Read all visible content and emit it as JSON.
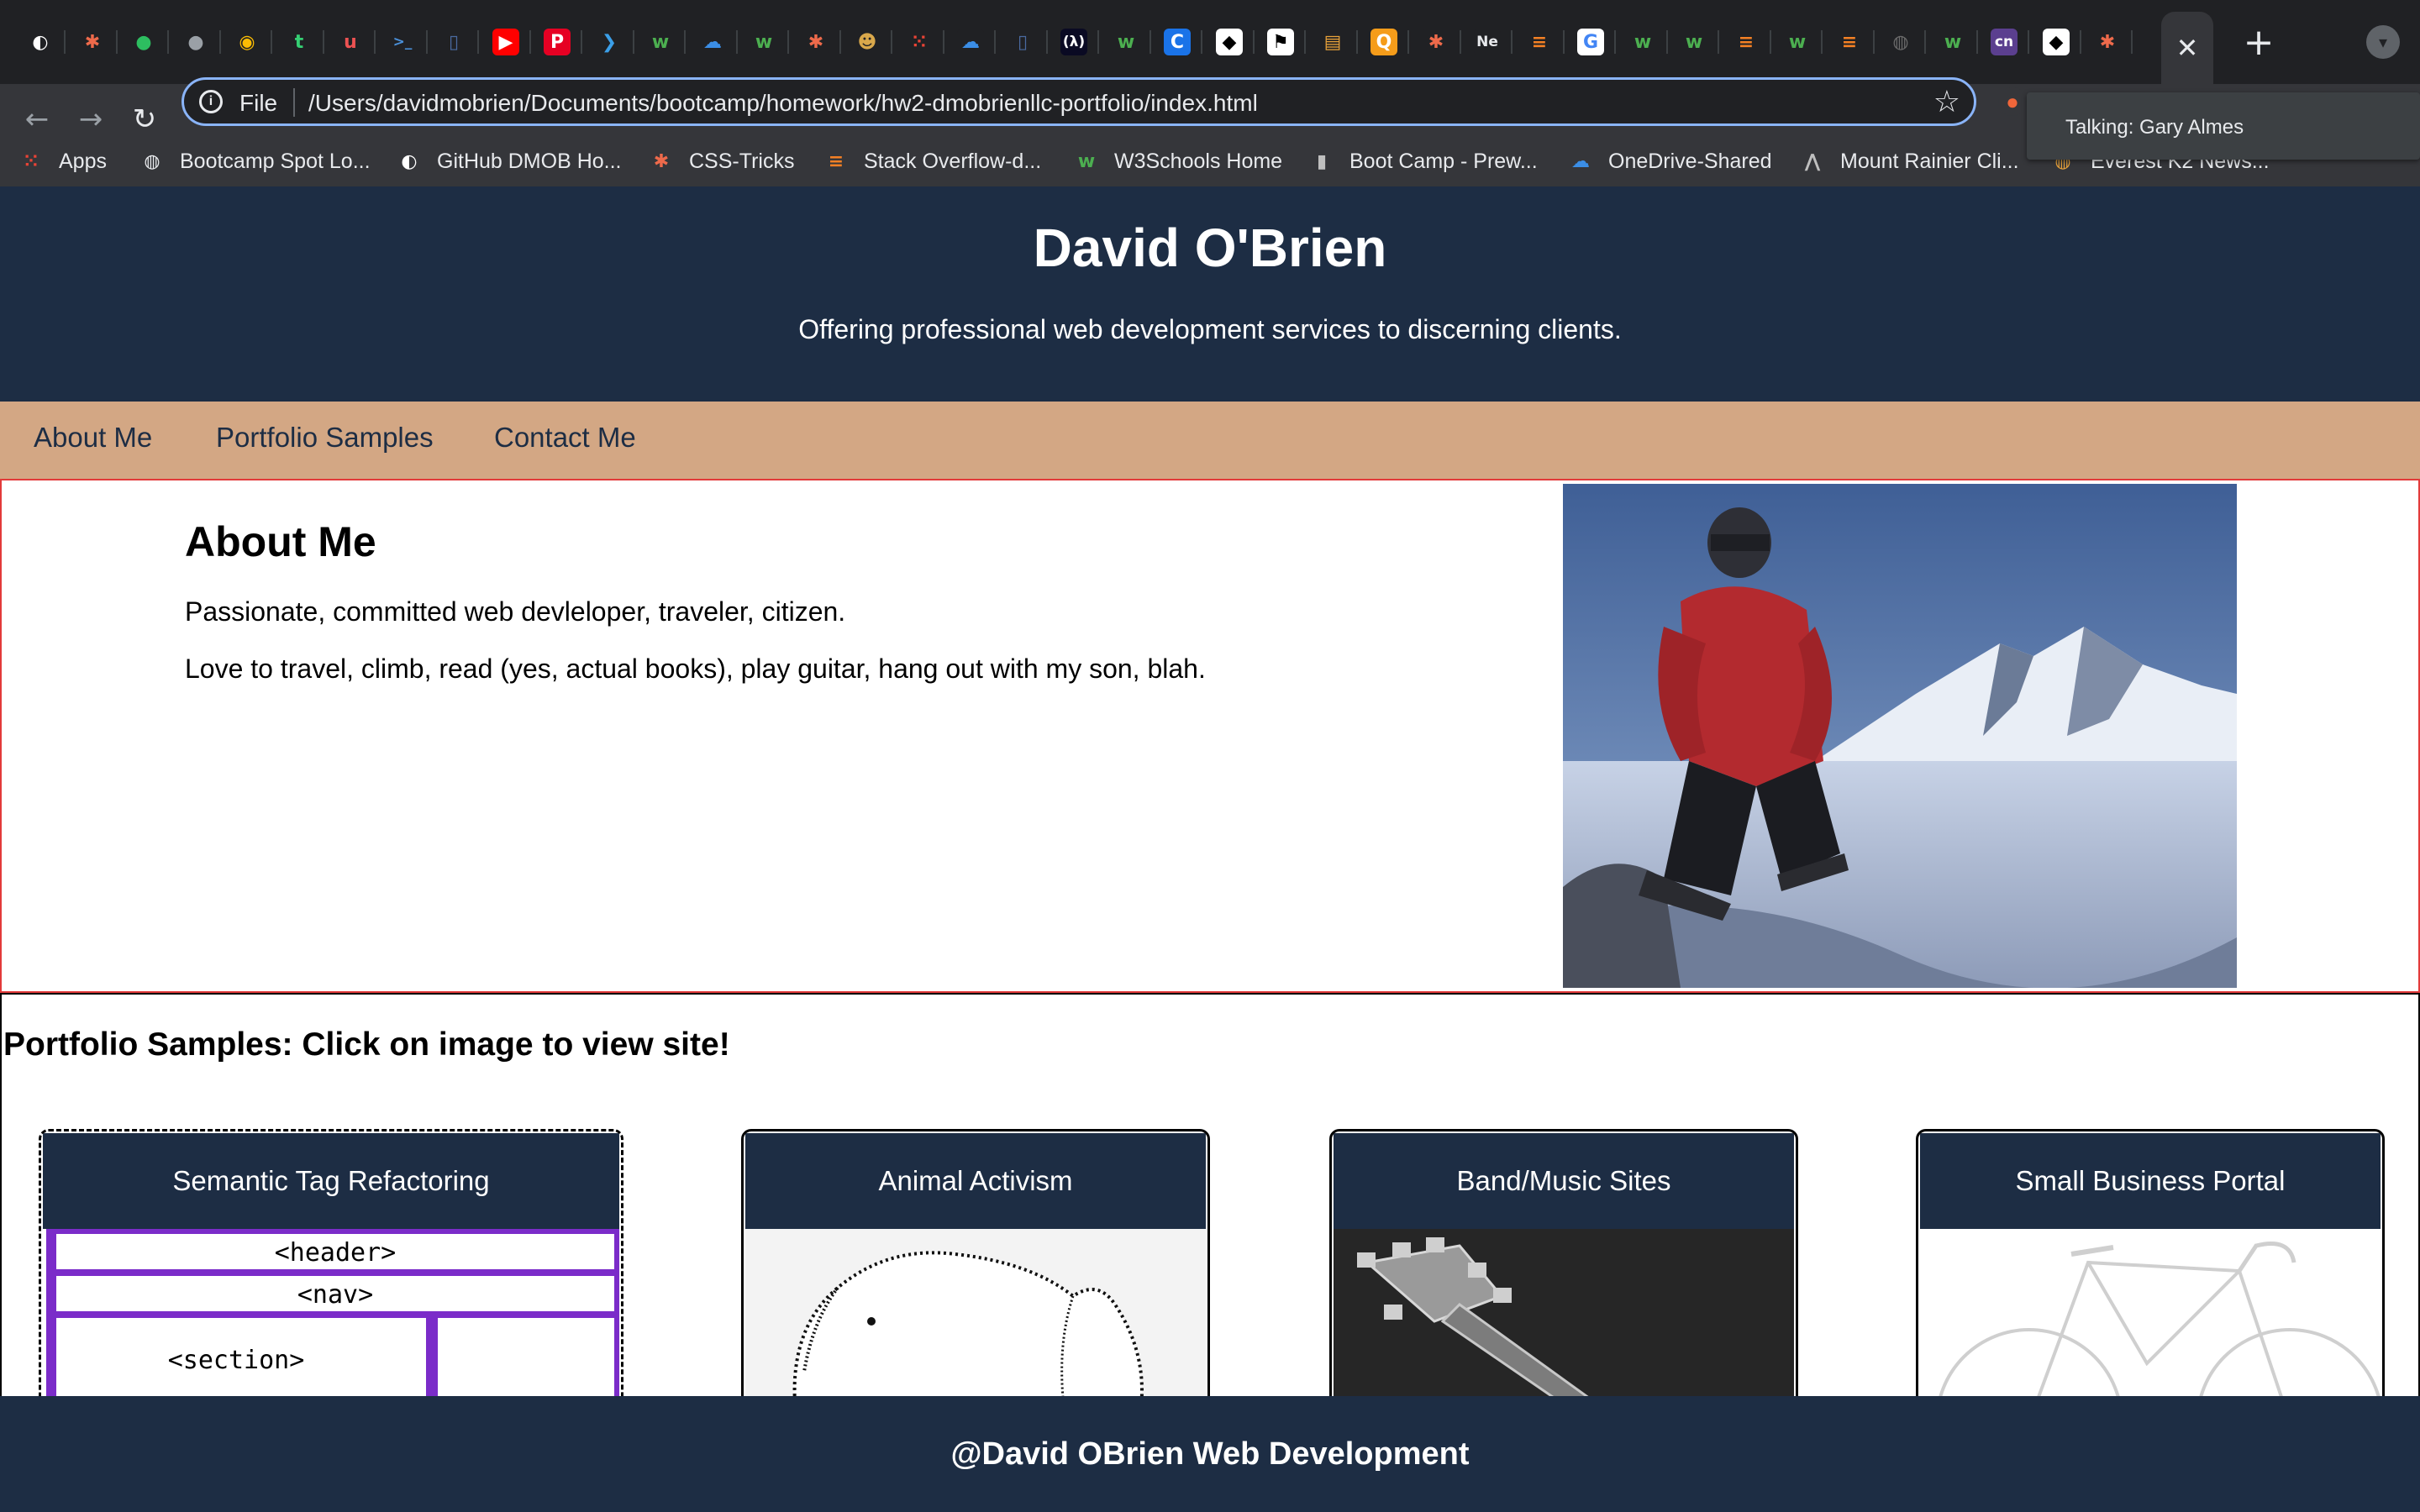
{
  "browser": {
    "tabs": [
      {
        "icon": "github-icon",
        "glyph": "◐",
        "color": "#ffffff",
        "bg": "#202124"
      },
      {
        "icon": "asterisk-icon",
        "glyph": "✱",
        "color": "#ee6a4b",
        "bg": "#202124"
      },
      {
        "icon": "evernote-icon",
        "glyph": "●",
        "color": "#2dbe60",
        "bg": "#202124"
      },
      {
        "icon": "apple-icon",
        "glyph": "●",
        "color": "#9aa0a6",
        "bg": "#202124"
      },
      {
        "icon": "chrome-icon",
        "glyph": "◉",
        "color": "#fbbc04",
        "bg": "#202124"
      },
      {
        "icon": "tumblr-icon",
        "glyph": "t",
        "color": "#35d073",
        "bg": "#202124"
      },
      {
        "icon": "udemy-icon",
        "glyph": "u",
        "color": "#ec5252",
        "bg": "#202124"
      },
      {
        "icon": "terminal-icon",
        "glyph": ">_",
        "color": "#4a90d9",
        "bg": "#202124"
      },
      {
        "icon": "doc-icon",
        "glyph": "▯",
        "color": "#4a6aa0",
        "bg": "#202124"
      },
      {
        "icon": "youtube-icon",
        "glyph": "▶",
        "color": "#ffffff",
        "bg": "#ff0000"
      },
      {
        "icon": "pinterest-icon",
        "glyph": "P",
        "color": "#ffffff",
        "bg": "#e60023"
      },
      {
        "icon": "vscode-icon",
        "glyph": "❯",
        "color": "#3b9fe8",
        "bg": "#202124"
      },
      {
        "icon": "w3schools-icon",
        "glyph": "w",
        "color": "#4caf50",
        "bg": "#202124"
      },
      {
        "icon": "onedrive-icon",
        "glyph": "☁",
        "color": "#3b8ee6",
        "bg": "#202124"
      },
      {
        "icon": "w3schools-icon",
        "glyph": "w",
        "color": "#4caf50",
        "bg": "#202124"
      },
      {
        "icon": "asterisk-icon",
        "glyph": "✱",
        "color": "#ee6a4b",
        "bg": "#202124"
      },
      {
        "icon": "character-icon",
        "glyph": "☻",
        "color": "#d9a84b",
        "bg": "#202124"
      },
      {
        "icon": "apps-grid-icon",
        "glyph": "⁙",
        "color": "#ea4335",
        "bg": "#202124"
      },
      {
        "icon": "onedrive-icon",
        "glyph": "☁",
        "color": "#3b8ee6",
        "bg": "#202124"
      },
      {
        "icon": "doc-icon",
        "glyph": "▯",
        "color": "#4a6aa0",
        "bg": "#202124"
      },
      {
        "icon": "freecodecamp-icon",
        "glyph": "(λ)",
        "color": "#ffffff",
        "bg": "#0a0a23"
      },
      {
        "icon": "w3schools-icon",
        "glyph": "w",
        "color": "#4caf50",
        "bg": "#202124"
      },
      {
        "icon": "c-logo-icon",
        "glyph": "C",
        "color": "#ffffff",
        "bg": "#1a73e8"
      },
      {
        "icon": "bootcamp-icon",
        "glyph": "◆",
        "color": "#000000",
        "bg": "#ffffff"
      },
      {
        "icon": "flag-icon",
        "glyph": "⚑",
        "color": "#000000",
        "bg": "#ffffff"
      },
      {
        "icon": "book-icon",
        "glyph": "▤",
        "color": "#e8a23a",
        "bg": "#202124"
      },
      {
        "icon": "q-logo-icon",
        "glyph": "Q",
        "color": "#ffffff",
        "bg": "#f59c1a"
      },
      {
        "icon": "asterisk-icon",
        "glyph": "✱",
        "color": "#ee6a4b",
        "bg": "#202124"
      },
      {
        "icon": "ne-icon",
        "glyph": "Ne",
        "color": "#e8eaed",
        "bg": "#202124"
      },
      {
        "icon": "stackoverflow-icon",
        "glyph": "≡",
        "color": "#f48024",
        "bg": "#202124"
      },
      {
        "icon": "google-icon",
        "glyph": "G",
        "color": "#4285f4",
        "bg": "#ffffff"
      },
      {
        "icon": "w3schools-icon",
        "glyph": "w",
        "color": "#4caf50",
        "bg": "#202124"
      },
      {
        "icon": "w3schools-icon",
        "glyph": "w",
        "color": "#4caf50",
        "bg": "#202124"
      },
      {
        "icon": "stackoverflow-icon",
        "glyph": "≡",
        "color": "#f48024",
        "bg": "#202124"
      },
      {
        "icon": "w3schools-icon",
        "glyph": "w",
        "color": "#4caf50",
        "bg": "#202124"
      },
      {
        "icon": "stackoverflow-icon",
        "glyph": "≡",
        "color": "#f48024",
        "bg": "#202124"
      },
      {
        "icon": "globe-icon",
        "glyph": "◍",
        "color": "#6b6b6b",
        "bg": "#202124"
      },
      {
        "icon": "w3schools-icon",
        "glyph": "w",
        "color": "#4caf50",
        "bg": "#202124"
      },
      {
        "icon": "cn-icon",
        "glyph": "cn",
        "color": "#ffffff",
        "bg": "#5b3f8f"
      },
      {
        "icon": "bootcamp-icon",
        "glyph": "◆",
        "color": "#000000",
        "bg": "#ffffff"
      },
      {
        "icon": "asterisk-icon",
        "glyph": "✱",
        "color": "#ee6a4b",
        "bg": "#202124"
      }
    ],
    "active_tab_close": "✕",
    "new_tab": "+",
    "url_scheme_label": "File",
    "url": "/Users/davidmobrien/Documents/bootcamp/homework/hw2-dmobrienllc-portfolio/index.html",
    "tooltip": "Talking: Gary Almes",
    "bookmarks": [
      {
        "label": "Apps",
        "icon": "apps-grid-icon",
        "glyph": "⁙",
        "color": "#ea4335"
      },
      {
        "label": "Bootcamp Spot Lo...",
        "icon": "globe-icon",
        "glyph": "◍",
        "color": "#e8eaed"
      },
      {
        "label": "GitHub DMOB Ho...",
        "icon": "github-icon",
        "glyph": "◐",
        "color": "#ffffff"
      },
      {
        "label": "CSS-Tricks",
        "icon": "asterisk-icon",
        "glyph": "✱",
        "color": "#ee6a4b"
      },
      {
        "label": "Stack Overflow-d...",
        "icon": "stackoverflow-icon",
        "glyph": "≡",
        "color": "#f48024"
      },
      {
        "label": "W3Schools Home",
        "icon": "w3schools-icon",
        "glyph": "w",
        "color": "#4caf50"
      },
      {
        "label": "Boot Camp - Prew...",
        "icon": "book-icon",
        "glyph": "▮",
        "color": "#bfbfbf"
      },
      {
        "label": "OneDrive-Shared",
        "icon": "onedrive-icon",
        "glyph": "☁",
        "color": "#3b8ee6"
      },
      {
        "label": "Mount Rainier Cli...",
        "icon": "mountain-icon",
        "glyph": "⋀",
        "color": "#bfbfbf"
      },
      {
        "label": "Everest K2 News...",
        "icon": "globe-icon",
        "glyph": "◍",
        "color": "#e8a23a"
      }
    ]
  },
  "site": {
    "title": "David O'Brien",
    "tagline": "Offering professional web development services to discerning clients.",
    "nav": [
      "About Me",
      "Portfolio Samples",
      "Contact Me"
    ],
    "about": {
      "heading": "About Me",
      "p1": "Passionate, committed web devleloper, traveler, citizen.",
      "p2": "Love to travel, climb, read (yes, actual books), play guitar, hang out with my son, blah."
    },
    "portfolio": {
      "heading": "Portfolio Samples: Click on image to view site!",
      "cards": [
        {
          "title": "Semantic Tag Refactoring",
          "tags": [
            "<header>",
            "<nav>",
            "<section>"
          ]
        },
        {
          "title": "Animal Activism"
        },
        {
          "title": "Band/Music Sites"
        },
        {
          "title": "Small Business Portal"
        }
      ]
    },
    "footer": "@David OBrien Web Development",
    "colors": {
      "navy": "#1d2d44",
      "nav_tan": "#d3a784",
      "about_border": "#e23a3a"
    }
  }
}
